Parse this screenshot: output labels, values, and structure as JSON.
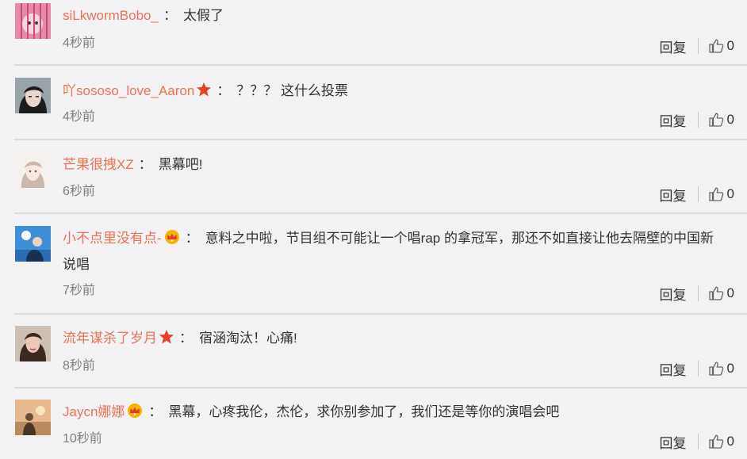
{
  "colors": {
    "username": "#eb7350",
    "background": "#f2f2f5",
    "time": "#808080"
  },
  "separator": "：",
  "comments": [
    {
      "user": "siLkwormBobo_",
      "badge": "",
      "text": "太假了",
      "text_line2": "",
      "time": "4秒前",
      "reply": "回复",
      "likes": "0",
      "avatar_icon": "avatar-pink-cage"
    },
    {
      "user": "吖sososo_love_Aaron",
      "badge": "star-badge-icon",
      "text": "？？？ 这什么投票",
      "text_line2": "",
      "time": "4秒前",
      "reply": "回复",
      "likes": "0",
      "avatar_icon": "avatar-dark-hair"
    },
    {
      "user": "芒果很拽XZ",
      "badge": "",
      "text": "黑幕吧!",
      "text_line2": "",
      "time": "6秒前",
      "reply": "回复",
      "likes": "0",
      "avatar_icon": "avatar-girl-light"
    },
    {
      "user": "小不点里没有点-",
      "badge": "crown-badge-icon",
      "text": "意料之中啦，节目组不可能让一个唱rap 的拿冠军，那还不如直接让他去隔壁的中国新",
      "text_line2": "说唱",
      "time": "7秒前",
      "reply": "回复",
      "likes": "0",
      "avatar_icon": "avatar-blue-sky"
    },
    {
      "user": "流年谋杀了岁月",
      "badge": "star-badge-icon",
      "text": "宿涵淘汰！心痛!",
      "text_line2": "",
      "time": "8秒前",
      "reply": "回复",
      "likes": "0",
      "avatar_icon": "avatar-girl-portrait"
    },
    {
      "user": "Jaycn娜娜",
      "badge": "crown-badge-icon",
      "text": "黑幕，心疼我伦，杰伦，求你别参加了，我们还是等你的演唱会吧",
      "text_line2": "",
      "time": "10秒前",
      "reply": "回复",
      "likes": "0",
      "avatar_icon": "avatar-sunset-girl"
    }
  ]
}
